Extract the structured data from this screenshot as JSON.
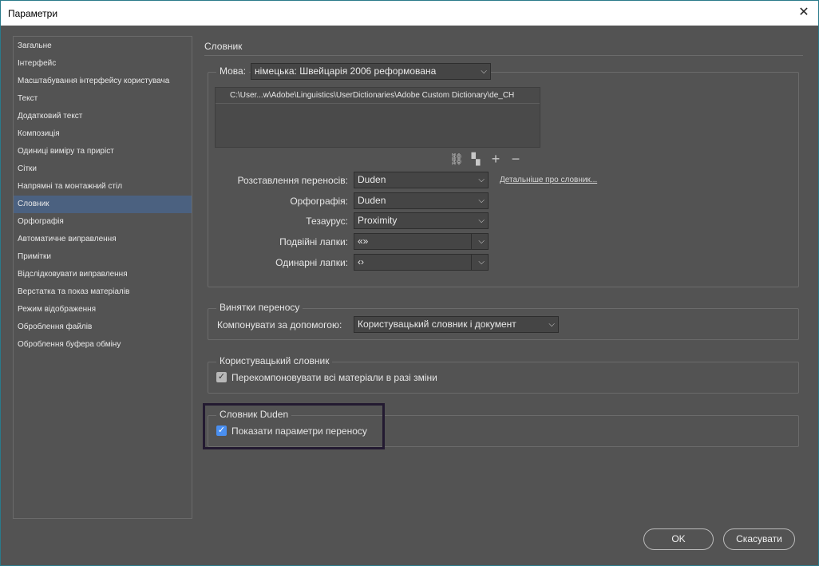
{
  "window": {
    "title": "Параметри"
  },
  "sidebar": {
    "items": [
      {
        "label": "Загальне"
      },
      {
        "label": "Інтерфейс"
      },
      {
        "label": "Масштабування інтерфейсу користувача"
      },
      {
        "label": "Текст"
      },
      {
        "label": "Додатковий текст"
      },
      {
        "label": "Композиція"
      },
      {
        "label": "Одиниці виміру та приріст"
      },
      {
        "label": "Сітки"
      },
      {
        "label": "Напрямні та монтажний стіл"
      },
      {
        "label": "Словник",
        "active": true
      },
      {
        "label": "Орфографія"
      },
      {
        "label": "Автоматичне виправлення"
      },
      {
        "label": "Примітки"
      },
      {
        "label": "Відслідковувати виправлення"
      },
      {
        "label": "Верстатка та показ матеріалів"
      },
      {
        "label": "Режим відображення"
      },
      {
        "label": "Оброблення файлів"
      },
      {
        "label": "Оброблення буфера обміну"
      }
    ]
  },
  "main": {
    "title": "Словник",
    "language": {
      "label": "Мова:",
      "value": "німецька: Швейцарія 2006 реформована"
    },
    "dictionary_path": "C:\\User...w\\Adobe\\Linguistics\\UserDictionaries\\Adobe Custom Dictionary\\de_CH",
    "hyphenation": {
      "label": "Розставлення переносів:",
      "value": "Duden"
    },
    "spelling": {
      "label": "Орфографія:",
      "value": "Duden"
    },
    "thesaurus": {
      "label": "Тезаурус:",
      "value": "Proximity"
    },
    "double_quotes": {
      "label": "Подвійні лапки:",
      "value": "«»"
    },
    "single_quotes": {
      "label": "Одинарні лапки:",
      "value": "‹›"
    },
    "more_info_link": "Детальніше про словник...",
    "hyphenation_exceptions": {
      "title": "Винятки переносу",
      "compose_label": "Компонувати за допомогою:",
      "compose_value": "Користувацький словник і документ"
    },
    "user_dictionary": {
      "title": "Користувацький словник",
      "recompose_label": "Перекомпоновувати всі матеріали в разі зміни",
      "recompose_checked": true
    },
    "duden_dictionary": {
      "title": "Словник Duden",
      "show_options_label": "Показати параметри переносу",
      "show_options_checked": true
    }
  },
  "buttons": {
    "ok": "OK",
    "cancel": "Скасувати"
  },
  "colors": {
    "background": "#535353",
    "active_item": "#4b6180",
    "checkbox_blue": "#4a8ff0",
    "highlight_border": "#231a31"
  }
}
